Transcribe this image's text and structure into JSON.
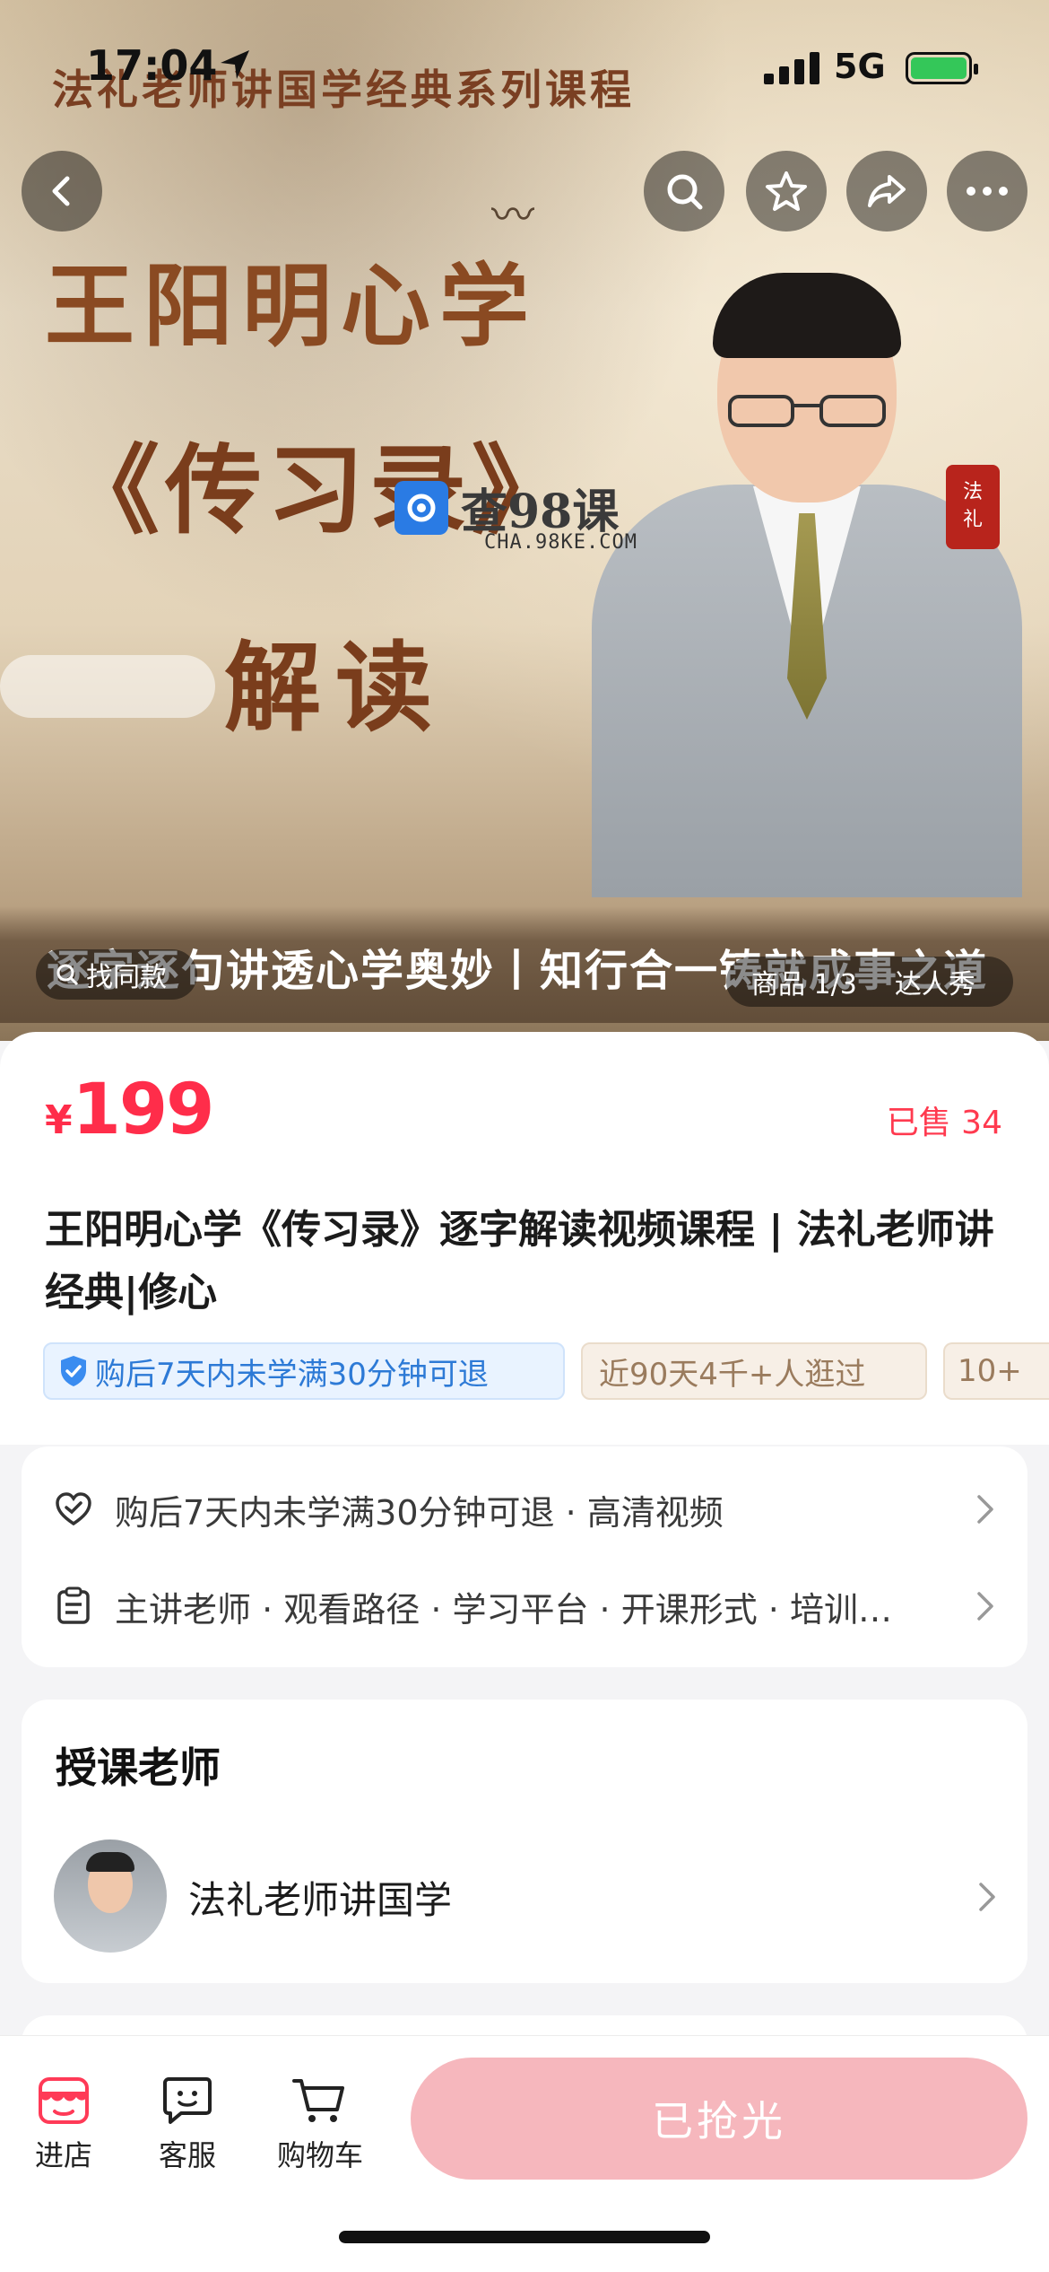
{
  "status_bar": {
    "time": "17:04",
    "network": "5G"
  },
  "hero": {
    "series_title": "法礼老师讲国学经典系列课程",
    "main_title": "王阳明心学",
    "sub_title": "《传习录》",
    "read_title": "解读",
    "seal_line1": "法",
    "seal_line2": "礼",
    "watermark_text": "查98课",
    "watermark_url": "CHA.98KE.COM",
    "banner_text": "逐字逐句讲透心学奥妙丨知行合一铸就成事之道",
    "find_similar": "找同款",
    "counter": "商品 1/3",
    "show_label": "达人秀"
  },
  "product": {
    "currency": "¥",
    "price": "199",
    "sold": "已售 34",
    "title": "王阳明心学《传习录》逐字解读视频课程 | 法礼老师讲经典|修心",
    "tag_refund": "购后7天内未学满30分钟可退",
    "tag_views": "近90天4千+人逛过",
    "tag_more": "10+"
  },
  "info": {
    "row1": "购后7天内未学满30分钟可退 · 高清视频",
    "row2": "主讲老师 · 观看路径 · 学习平台 · 开课形式 · 培训…"
  },
  "teacher": {
    "heading": "授课老师",
    "name": "法礼老师讲国学"
  },
  "bottom_bar": {
    "store": "进店",
    "service": "客服",
    "cart": "购物车",
    "buy": "已抢光"
  },
  "colors": {
    "price_red": "#ff2d4a",
    "buy_disabled": "#f6b7bd",
    "refund_blue": "#2d7ad6"
  }
}
